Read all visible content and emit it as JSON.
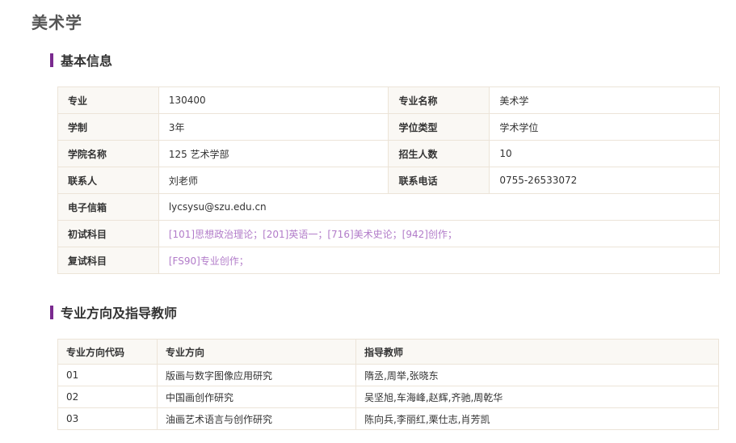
{
  "page_title": "美术学",
  "sections": {
    "basic_info": "基本信息",
    "directions": "专业方向及指导教师"
  },
  "info": {
    "major_code_label": "专业",
    "major_code": "130400",
    "major_name_label": "专业名称",
    "major_name": "美术学",
    "duration_label": "学制",
    "duration": "3年",
    "degree_type_label": "学位类型",
    "degree_type": "学术学位",
    "college_label": "学院名称",
    "college": "125 艺术学部",
    "enrollment_label": "招生人数",
    "enrollment": "10",
    "contact_label": "联系人",
    "contact": "刘老师",
    "phone_label": "联系电话",
    "phone": "0755-26533072",
    "email_label": "电子信箱",
    "email": "lycsysu@szu.edu.cn",
    "prelim_label": "初试科目",
    "prelim": "[101]思想政治理论；[201]英语一；[716]美术史论；[942]创作；",
    "retest_label": "复试科目",
    "retest": "[FS90]专业创作；"
  },
  "directions": {
    "headers": [
      "专业方向代码",
      "专业方向",
      "指导教师"
    ],
    "rows": [
      {
        "code": "01",
        "name": "版画与数字图像应用研究",
        "teachers": "隋丞,周举,张晓东"
      },
      {
        "code": "02",
        "name": "中国画创作研究",
        "teachers": "吴坚旭,车海峰,赵辉,齐驰,周乾华"
      },
      {
        "code": "03",
        "name": "油画艺术语言与创作研究",
        "teachers": "陈向兵,李丽红,栗仕志,肖芳凯"
      }
    ]
  },
  "colors": {
    "accent": "#7a2a8f",
    "link": "#b27cc9",
    "border": "#ece4d8",
    "label_bg": "#faf8f4"
  }
}
